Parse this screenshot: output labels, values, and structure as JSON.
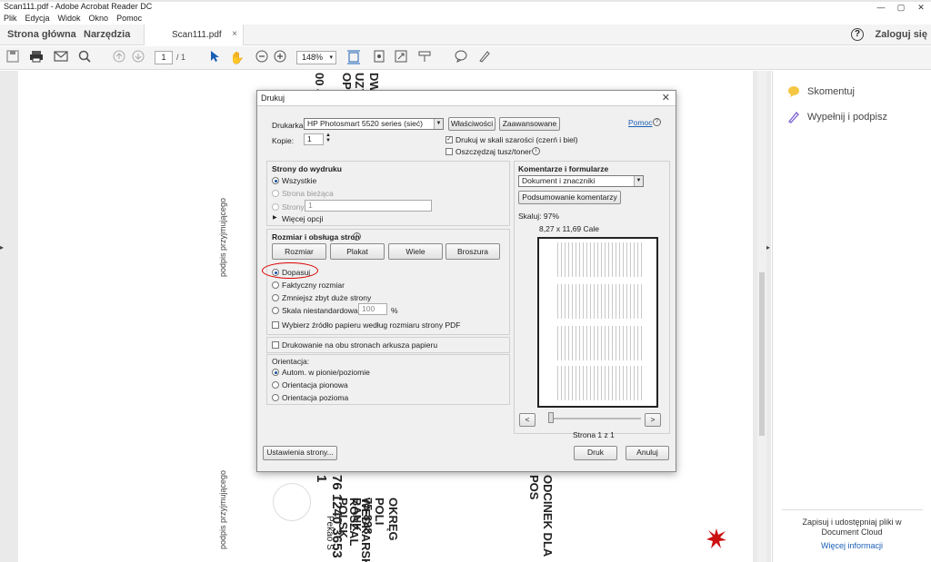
{
  "window": {
    "title": "Scan111.pdf - Adobe Acrobat Reader DC"
  },
  "menu": [
    "Plik",
    "Edycja",
    "Widok",
    "Okno",
    "Pomoc"
  ],
  "header": {
    "home": "Strona główna",
    "tools": "Narzędzia",
    "doc_tab": "Scan111.pdf",
    "login": "Zaloguj się",
    "help": "?"
  },
  "toolbar": {
    "page_current": "1",
    "page_total": "/ 1",
    "zoom": "148%"
  },
  "right_panel": {
    "comment": "Skomentuj",
    "fill_sign": "Wypełnij i podpisz",
    "footer": "Zapisuj i udostępniaj pliki w Document Cloud",
    "more_info": "Więcej informacji"
  },
  "document": {
    "vertical_texts": [
      "podpis przyjmującego",
      "podpis przyjmującego",
      "ODCINEK DLA POS",
      "76 1240 3653 1",
      "BANK POLSK",
      "OKRĘG POLI",
      "WEDKARSKIE",
      "75-838 KOSZAL",
      "Pekao S",
      "00 4",
      "OPIE",
      "UZYC",
      "DWA"
    ]
  },
  "dialog": {
    "title": "Drukuj",
    "printer_label": "Drukarka:",
    "printer_value": "HP Photosmart 5520 series (sieć)",
    "properties_btn": "Właściwości",
    "advanced_btn": "Zaawansowane",
    "help_link": "Pomoc",
    "copies_label": "Kopie:",
    "copies_value": "1",
    "grayscale": "Drukuj w skali szarości (czerń i biel)",
    "save_toner": "Oszczędzaj tusz/toner",
    "pages_header": "Strony do wydruku",
    "pages_all": "Wszystkie",
    "pages_current": "Strona bieżąca",
    "pages_range": "Strony",
    "pages_range_value": "1",
    "more_options": "Więcej opcji",
    "sizing_header": "Rozmiar i obsługa stron",
    "tab_size": "Rozmiar",
    "tab_poster": "Plakat",
    "tab_multiple": "Wiele",
    "tab_booklet": "Broszura",
    "fit": "Dopasuj",
    "actual": "Faktyczny rozmiar",
    "shrink": "Zmniejsz zbyt duże strony",
    "custom_scale": "Skala niestandardowa:",
    "custom_scale_value": "100",
    "percent": "%",
    "paper_source": "Wybierz źródło papieru według rozmiaru strony PDF",
    "duplex": "Drukowanie na obu stronach arkusza papieru",
    "orientation_label": "Orientacja:",
    "orient_auto": "Autom. w pionie/poziomie",
    "orient_portrait": "Orientacja pionowa",
    "orient_landscape": "Orientacja pozioma",
    "comments_header": "Komentarze i formularze",
    "comments_value": "Dokument i znaczniki",
    "summary_btn": "Podsumowanie komentarzy",
    "scale_text": "Skaluj:  97%",
    "paper_size": "8,27 x 11,69 Cale",
    "page_indicator": "Strona 1 z 1",
    "page_setup_btn": "Ustawienia strony...",
    "print_btn": "Druk",
    "cancel_btn": "Anuluj"
  }
}
